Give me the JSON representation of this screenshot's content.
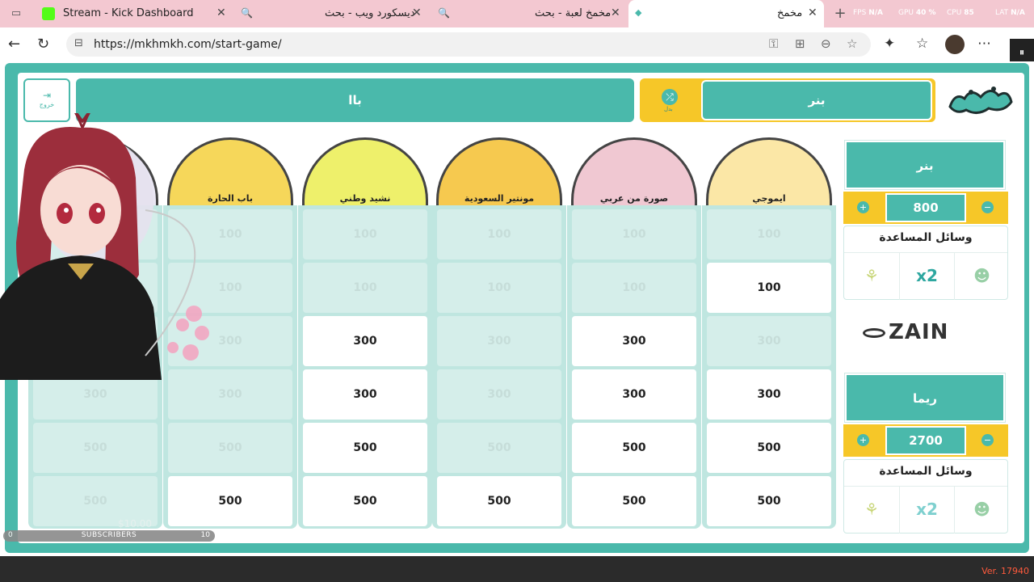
{
  "tabs": [
    {
      "title": "Stream - Kick Dashboard",
      "close": "✕"
    },
    {
      "title": "ديسكورد ويب - بحث",
      "close": "✕"
    },
    {
      "title": "مخمخ لعبة - بحث",
      "close": "✕"
    },
    {
      "title": "مخمخ",
      "close": "✕"
    }
  ],
  "perf": {
    "fps_label": "FPS",
    "fps": "N/A",
    "gpu_label": "GPU",
    "gpu": "40 %",
    "cpu_label": "CPU",
    "cpu": "85",
    "lat_label": "LAT",
    "lat": "N/A"
  },
  "address": {
    "url": "https://mkhmkh.com/start-game/"
  },
  "header": {
    "exit_label": "خروج",
    "team_a": "باا",
    "team_b": "بنر",
    "swap_label": "بدل"
  },
  "categories": [
    {
      "name": "ايموجي",
      "color": "#fbe7a6"
    },
    {
      "name": "صورة من عربي",
      "color": "#f0c8d2"
    },
    {
      "name": "مونتير السعودية",
      "color": "#f6c94f"
    },
    {
      "name": "نشيد وطني",
      "color": "#eef06b"
    },
    {
      "name": "باب الحارة",
      "color": "#f6d75a"
    },
    {
      "name": "",
      "color": "#e9e6f3"
    }
  ],
  "board": {
    "rows": [
      {
        "values": [
          "100",
          "100",
          "100",
          "100",
          "100",
          "100"
        ],
        "available": [
          false,
          false,
          false,
          false,
          false,
          false
        ]
      },
      {
        "values": [
          "100",
          "100",
          "100",
          "100",
          "100",
          "100"
        ],
        "available": [
          true,
          false,
          false,
          false,
          false,
          false
        ]
      },
      {
        "values": [
          "300",
          "300",
          "300",
          "300",
          "300",
          "300"
        ],
        "available": [
          false,
          true,
          false,
          true,
          false,
          false
        ]
      },
      {
        "values": [
          "300",
          "300",
          "300",
          "300",
          "300",
          "300"
        ],
        "available": [
          true,
          true,
          false,
          true,
          false,
          false
        ]
      },
      {
        "values": [
          "500",
          "500",
          "500",
          "500",
          "500",
          "500"
        ],
        "available": [
          true,
          true,
          false,
          true,
          false,
          false
        ]
      },
      {
        "values": [
          "500",
          "500",
          "500",
          "500",
          "500",
          "500"
        ],
        "available": [
          true,
          true,
          true,
          true,
          true,
          false
        ]
      }
    ]
  },
  "right_panel": {
    "team1": {
      "name": "بنر",
      "score": "800"
    },
    "team2": {
      "name": "ريما",
      "score": "2700"
    },
    "aids_title": "وسائل المساعدة",
    "plus": "+",
    "minus": "−",
    "aid_icons": [
      "lemon-icon",
      "x2-icon",
      "person-icon"
    ],
    "x2_label": "x2",
    "sponsor": "ZAIN"
  },
  "overlay": {
    "subscribers_label": "SUBSCRIBERS",
    "sub_min": "0",
    "sub_max": "10",
    "sub_amount": "$10.00"
  },
  "footer": {
    "version": "Ver. 17940"
  },
  "colors": {
    "teal": "#4ab9ab",
    "yellow": "#f6c728",
    "tab_bg": "#f3c8d1"
  }
}
